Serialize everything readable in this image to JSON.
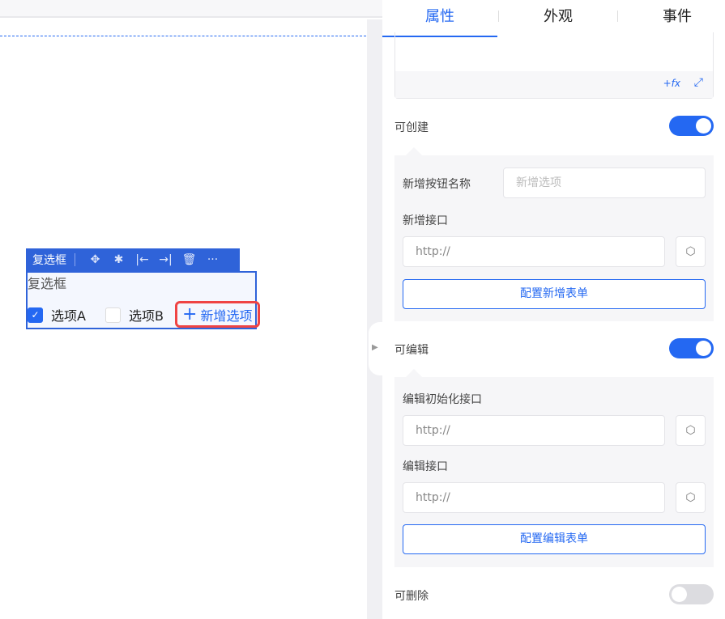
{
  "canvas": {
    "toolbar": {
      "title": "复选框",
      "icons": [
        "move-icon",
        "bug-icon",
        "align-left-icon",
        "align-right-icon",
        "trash-icon",
        "more-icon"
      ]
    },
    "component": {
      "title": "复选框",
      "options": [
        {
          "label": "选项A",
          "checked": true
        },
        {
          "label": "选项B",
          "checked": false
        }
      ],
      "add_option": "新增选项"
    }
  },
  "panel": {
    "tabs": [
      "属性",
      "外观",
      "事件"
    ],
    "active_tab": "属性",
    "fx_label": "+fx",
    "creatable": {
      "label": "可创建",
      "on": true,
      "button_name_label": "新增按钮名称",
      "button_name_placeholder": "新增选项",
      "api_label": "新增接口",
      "api_value": "http://",
      "config_button": "配置新增表单"
    },
    "editable": {
      "label": "可编辑",
      "on": true,
      "init_api_label": "编辑初始化接口",
      "init_api_value": "http://",
      "api_label": "编辑接口",
      "api_value": "http://",
      "config_button": "配置编辑表单"
    },
    "removable": {
      "label": "可删除",
      "on": false
    },
    "accent": "#2468f2"
  }
}
